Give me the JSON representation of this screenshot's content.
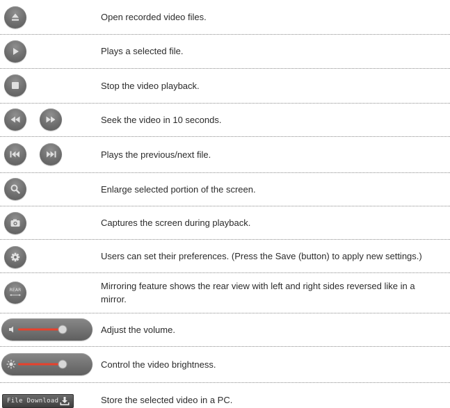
{
  "rows": [
    {
      "icons": [
        "eject-icon"
      ],
      "text": "Open recorded video files."
    },
    {
      "icons": [
        "play-icon"
      ],
      "text": "Plays a selected file."
    },
    {
      "icons": [
        "stop-icon"
      ],
      "text": "Stop the video playback."
    },
    {
      "icons": [
        "rewind-icon",
        "fast-forward-icon"
      ],
      "text": "Seek the video in 10 seconds."
    },
    {
      "icons": [
        "previous-file-icon",
        "next-file-icon"
      ],
      "text": "Plays the previous/next file."
    },
    {
      "icons": [
        "magnifier-icon"
      ],
      "text": "Enlarge selected portion of the screen."
    },
    {
      "icons": [
        "camera-icon"
      ],
      "text": "Captures the screen during playback."
    },
    {
      "icons": [
        "gear-icon"
      ],
      "text": "Users can set their preferences. (Press the Save (button) to apply new settings.)"
    },
    {
      "icons": [
        "rear-mirror-icon"
      ],
      "icon_text": "REAR",
      "text": "Mirroring feature shows the rear view with left and right sides reversed like in a mirror."
    },
    {
      "icons": [
        "volume-slider"
      ],
      "text": "Adjust the volume."
    },
    {
      "icons": [
        "brightness-slider"
      ],
      "text": "Control the video brightness."
    },
    {
      "icons": [
        "file-download-button"
      ],
      "button_label": "File Download",
      "text": "Store the selected video in a PC."
    }
  ],
  "colors": {
    "icon_bg": "#6e6e6e",
    "slider_track": "#e8412c",
    "text": "#2b2b2b",
    "divider": "#8a8a8a"
  }
}
